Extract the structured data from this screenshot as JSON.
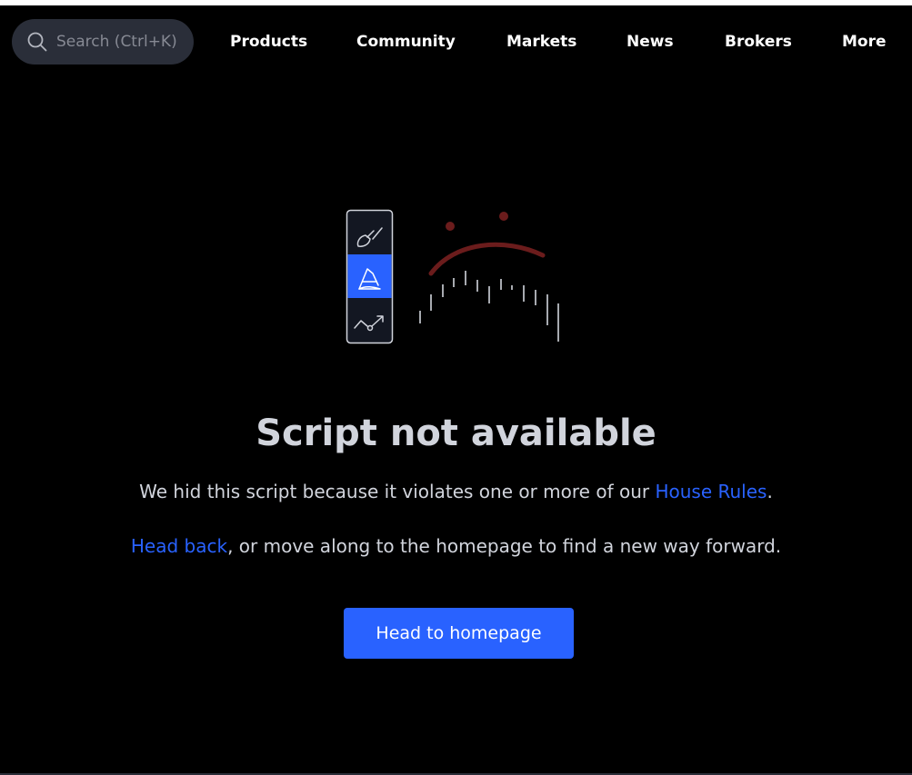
{
  "header": {
    "search": {
      "placeholder": "Search (Ctrl+K)",
      "icon": "search-icon"
    },
    "nav": [
      {
        "label": "Products"
      },
      {
        "label": "Community"
      },
      {
        "label": "Markets"
      },
      {
        "label": "News"
      },
      {
        "label": "Brokers"
      },
      {
        "label": "More"
      }
    ]
  },
  "illustration": {
    "toolbar_icons": [
      "brush-icon",
      "eraser-icon",
      "trend-icon"
    ],
    "active_icon": "eraser-icon",
    "frown_color": "#6b1c1c",
    "active_color": "#2962ff"
  },
  "content": {
    "title": "Script not available",
    "line1_prefix": "We hid this script because it violates one or more of our ",
    "line1_link": "House Rules",
    "line1_suffix": ".",
    "line2_link": "Head back",
    "line2_suffix": ", or move along to the homepage to find a new way forward.",
    "cta_label": "Head to homepage"
  },
  "colors": {
    "background": "#000000",
    "accent": "#2962ff",
    "text": "#d1d4dc"
  }
}
